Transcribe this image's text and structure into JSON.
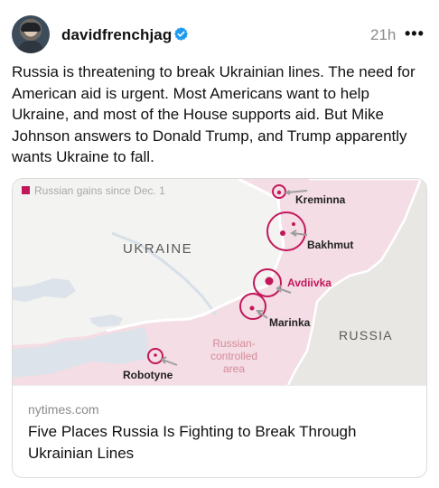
{
  "post": {
    "username": "davidfrenchjag",
    "timestamp": "21h",
    "more_label": "•••",
    "body": "Russia is threatening to break Ukrainian lines. The need for American aid is urgent. Most Americans want to help Ukraine, and most of the House supports aid. But Mike Johnson answers to Donald Trump, and Trump apparently wants Ukraine to fall."
  },
  "link_card": {
    "domain": "nytimes.com",
    "headline": "Five Places Russia Is Fighting to Break Through Ukrainian Lines",
    "map": {
      "legend": "Russian gains since Dec. 1",
      "country_ukraine": "UKRAINE",
      "country_russia": "RUSSIA",
      "places": [
        "Kreminna",
        "Bakhmut",
        "Avdiivka",
        "Marinka",
        "Robotyne"
      ],
      "controlled_area": "Russian-\ncontrolled\narea"
    }
  },
  "colors": {
    "accent": "#c2185b",
    "occupied_fill": "#f4dde4",
    "verified_blue": "#1d9bf0"
  }
}
